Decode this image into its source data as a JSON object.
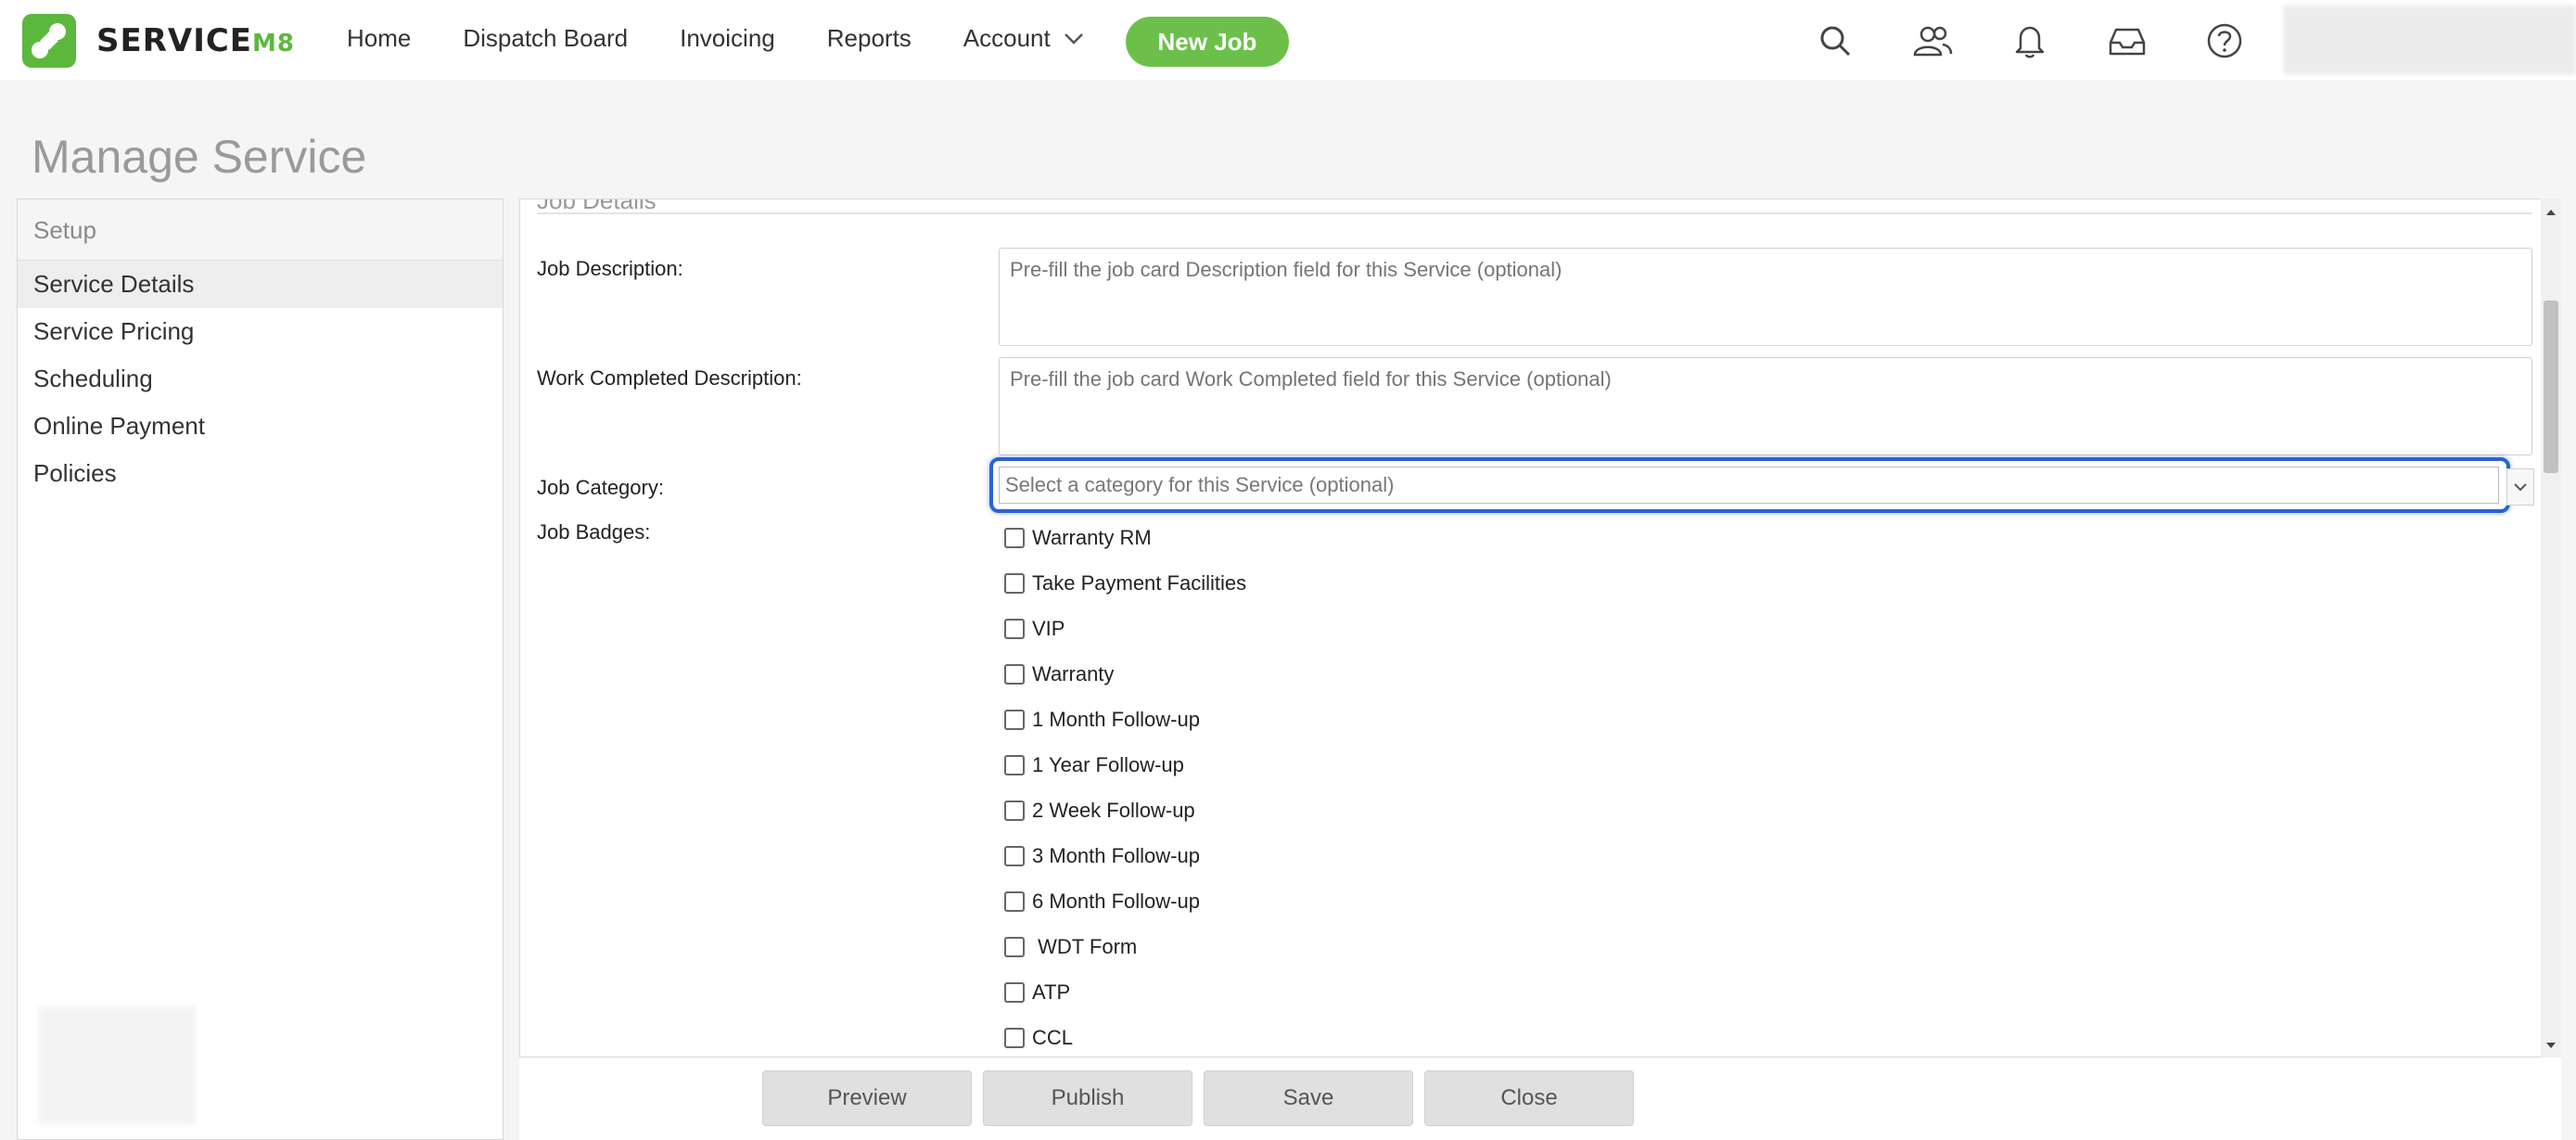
{
  "app": {
    "logo_text": "SERVICE",
    "logo_suffix": "M8"
  },
  "nav": {
    "home": "Home",
    "dispatch": "Dispatch Board",
    "invoicing": "Invoicing",
    "reports": "Reports",
    "account": "Account",
    "new_job": "New Job"
  },
  "page": {
    "title": "Manage Service"
  },
  "sidebar": {
    "header": "Setup",
    "items": [
      {
        "label": "Service Details",
        "active": true
      },
      {
        "label": "Service Pricing"
      },
      {
        "label": "Scheduling"
      },
      {
        "label": "Online Payment"
      },
      {
        "label": "Policies"
      }
    ]
  },
  "form": {
    "section_title": "Job Details",
    "job_description_label": "Job Description:",
    "job_description_placeholder": "Pre-fill the job card Description field for this Service (optional)",
    "work_completed_label": "Work Completed Description:",
    "work_completed_placeholder": "Pre-fill the job card Work Completed field for this Service (optional)",
    "job_category_label": "Job Category:",
    "job_category_placeholder": "Select a category for this Service (optional)",
    "job_badges_label": "Job Badges:",
    "badges": [
      "Warranty RM",
      "Take Payment Facilities",
      "VIP",
      "Warranty",
      "1 Month Follow-up",
      "1 Year Follow-up",
      "2 Week Follow-up",
      "3 Month Follow-up",
      "6 Month Follow-up",
      " WDT Form",
      "ATP",
      "CCL"
    ]
  },
  "footer": {
    "preview": "Preview",
    "publish": "Publish",
    "save": "Save",
    "close": "Close"
  },
  "colors": {
    "brand_green": "#5cb83d",
    "focus_blue": "#2a62d8"
  }
}
